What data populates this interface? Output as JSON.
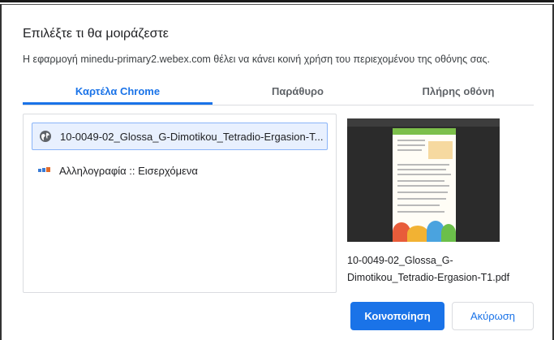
{
  "dialog": {
    "title": "Επιλέξτε τι θα μοιράζεστε",
    "subtitle": "Η εφαρμογή minedu-primary2.webex.com θέλει να κάνει κοινή χρήση του περιεχομένου της οθόνης σας."
  },
  "tabs": [
    {
      "label": "Καρτέλα Chrome",
      "selected": true
    },
    {
      "label": "Παράθυρο",
      "selected": false
    },
    {
      "label": "Πλήρης οθόνη",
      "selected": false
    }
  ],
  "list": {
    "items": [
      {
        "label": "10-0049-02_Glossa_G-Dimotikou_Tetradio-Ergasion-T...",
        "icon": "globe-icon",
        "selected": true
      },
      {
        "label": "Αλληλογραφία :: Εισερχόμενα",
        "icon": "mail-app-icon",
        "selected": false
      }
    ]
  },
  "preview": {
    "caption": "10-0049-02_Glossa_G-Dimotikou_Tetradio-Ergasion-T1.pdf"
  },
  "buttons": {
    "share": "Κοινοποίηση",
    "cancel": "Ακύρωση"
  },
  "colors": {
    "accent": "#1a73e8",
    "selected_bg": "#e8f0fe"
  }
}
